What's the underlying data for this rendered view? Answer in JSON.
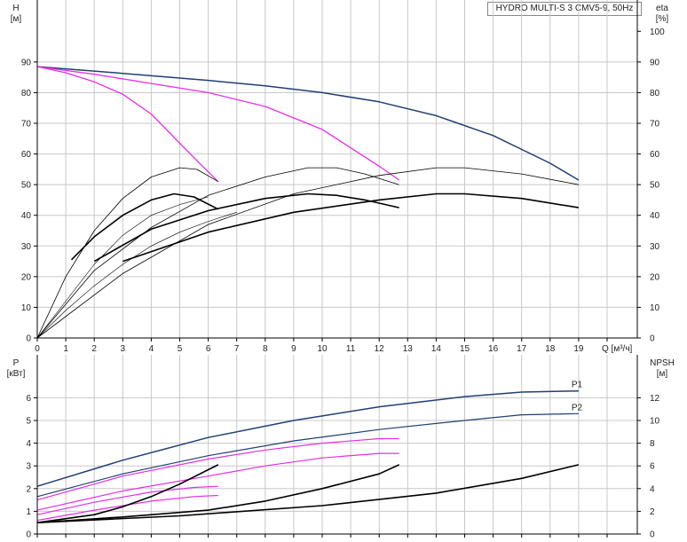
{
  "title": "HYDRO MULTI-S 3 CMV5-9, 50Hz",
  "chart_data": [
    {
      "type": "line",
      "name": "head-efficiency",
      "left_axis": {
        "label": "H",
        "unit": "[м]",
        "ylim": [
          0,
          100
        ],
        "ticks": [
          "0",
          "10",
          "20",
          "30",
          "40",
          "50",
          "60",
          "70",
          "80",
          "90"
        ]
      },
      "right_axis": {
        "label": "eta",
        "unit": "[%]",
        "ylim": [
          0,
          100
        ],
        "ticks": [
          "0",
          "10",
          "20",
          "30",
          "40",
          "50",
          "60",
          "70",
          "80",
          "90",
          "100"
        ]
      },
      "x_axis": {
        "label": "Q [м³/ч]",
        "xlim": [
          0,
          20
        ],
        "ticks": [
          "0",
          "1",
          "2",
          "3",
          "4",
          "5",
          "6",
          "7",
          "8",
          "9",
          "10",
          "11",
          "12",
          "13",
          "14",
          "15",
          "16",
          "17",
          "18",
          "19"
        ]
      },
      "grid": true,
      "series": [
        {
          "color": "#1f3f73",
          "width": 1.5,
          "points": [
            [
              0,
              88.5
            ],
            [
              3,
              86.3
            ],
            [
              6,
              84
            ],
            [
              8,
              82.2
            ],
            [
              10,
              80
            ],
            [
              12,
              77
            ],
            [
              14,
              72.5
            ],
            [
              16,
              66
            ],
            [
              18,
              57
            ],
            [
              19,
              51.5
            ]
          ]
        },
        {
          "color": "#e62ee6",
          "width": 1.3,
          "points": [
            [
              0,
              88.5
            ],
            [
              2,
              86
            ],
            [
              4,
              83
            ],
            [
              6,
              80
            ],
            [
              8,
              75.5
            ],
            [
              10,
              68
            ],
            [
              11,
              62
            ],
            [
              12,
              56
            ],
            [
              12.7,
              51.5
            ]
          ]
        },
        {
          "color": "#e62ee6",
          "width": 1.3,
          "points": [
            [
              0,
              88.5
            ],
            [
              1,
              86.5
            ],
            [
              2,
              83.5
            ],
            [
              3,
              79.5
            ],
            [
              4,
              73
            ],
            [
              5,
              63.5
            ],
            [
              5.8,
              56
            ],
            [
              6.35,
              51
            ]
          ]
        },
        {
          "color": "#000000",
          "width": 0.8,
          "points": [
            [
              0,
              0
            ],
            [
              1,
              20
            ],
            [
              2,
              35
            ],
            [
              3,
              45.5
            ],
            [
              4,
              52.5
            ],
            [
              5,
              55.5
            ],
            [
              5.6,
              55
            ],
            [
              6.35,
              51
            ]
          ]
        },
        {
          "color": "#000000",
          "width": 1.6,
          "points": [
            [
              1.2,
              25.5
            ],
            [
              2,
              33
            ],
            [
              3,
              40
            ],
            [
              4,
              45
            ],
            [
              4.8,
              47
            ],
            [
              5.5,
              46
            ],
            [
              6.35,
              42
            ]
          ]
        },
        {
          "color": "#000000",
          "width": 0.8,
          "points": [
            [
              0,
              0
            ],
            [
              2,
              22
            ],
            [
              4,
              36
            ],
            [
              6,
              46.5
            ],
            [
              8,
              52.5
            ],
            [
              9.5,
              55.5
            ],
            [
              10.5,
              55.5
            ],
            [
              11.5,
              53.5
            ],
            [
              12.7,
              50
            ]
          ]
        },
        {
          "color": "#000000",
          "width": 1.6,
          "points": [
            [
              2,
              25
            ],
            [
              4,
              35.5
            ],
            [
              6,
              41.5
            ],
            [
              8,
              45.5
            ],
            [
              9.5,
              47
            ],
            [
              10.5,
              46.5
            ],
            [
              11.5,
              45
            ],
            [
              12.7,
              42.5
            ]
          ]
        },
        {
          "color": "#000000",
          "width": 0.8,
          "points": [
            [
              0,
              0
            ],
            [
              3,
              21
            ],
            [
              6,
              37
            ],
            [
              9,
              47
            ],
            [
              12,
              53
            ],
            [
              14,
              55.5
            ],
            [
              15,
              55.5
            ],
            [
              17,
              53.5
            ],
            [
              19,
              50
            ]
          ]
        },
        {
          "color": "#000000",
          "width": 1.6,
          "points": [
            [
              3,
              25
            ],
            [
              6,
              34.5
            ],
            [
              9,
              41
            ],
            [
              12,
              45
            ],
            [
              14,
              47
            ],
            [
              15,
              47
            ],
            [
              17,
              45.5
            ],
            [
              19,
              42.5
            ]
          ]
        },
        {
          "color": "#000000",
          "width": 0.6,
          "points": [
            [
              0,
              0
            ],
            [
              1,
              12
            ],
            [
              2,
              24
            ],
            [
              3,
              33.5
            ],
            [
              4,
              40
            ],
            [
              5,
              43.5
            ],
            [
              6,
              46
            ]
          ]
        },
        {
          "color": "#000000",
          "width": 0.6,
          "points": [
            [
              0,
              0
            ],
            [
              1,
              9
            ],
            [
              2,
              17
            ],
            [
              3,
              24
            ],
            [
              4,
              30
            ],
            [
              5,
              34.5
            ],
            [
              6,
              38
            ],
            [
              7,
              41
            ]
          ]
        }
      ]
    },
    {
      "type": "line",
      "name": "power-npsh",
      "left_axis": {
        "label": "P",
        "unit": "[кВт]",
        "ylim": [
          0,
          7
        ],
        "ticks": [
          "0",
          "1",
          "2",
          "3",
          "4",
          "5",
          "6"
        ]
      },
      "right_axis": {
        "label": "NPSH",
        "unit": "[м]",
        "ylim": [
          0,
          14
        ],
        "ticks": [
          "0",
          "2",
          "4",
          "6",
          "8",
          "10",
          "12"
        ]
      },
      "x_axis": {
        "xlim": [
          0,
          20
        ]
      },
      "grid": true,
      "series": [
        {
          "name": "P1",
          "color": "#1f3f73",
          "width": 1.5,
          "points": [
            [
              0,
              2.1
            ],
            [
              3,
              3.25
            ],
            [
              6,
              4.25
            ],
            [
              9,
              5
            ],
            [
              12,
              5.6
            ],
            [
              15,
              6.05
            ],
            [
              17,
              6.25
            ],
            [
              19,
              6.3
            ]
          ]
        },
        {
          "name": "P2",
          "color": "#1f3f73",
          "width": 1.2,
          "points": [
            [
              0,
              1.65
            ],
            [
              3,
              2.65
            ],
            [
              6,
              3.45
            ],
            [
              9,
              4.1
            ],
            [
              12,
              4.6
            ],
            [
              15,
              5
            ],
            [
              17,
              5.25
            ],
            [
              19,
              5.3
            ]
          ]
        },
        {
          "color": "#e62ee6",
          "width": 1.2,
          "points": [
            [
              0,
              1.5
            ],
            [
              3,
              2.55
            ],
            [
              6,
              3.3
            ],
            [
              8,
              3.7
            ],
            [
              10,
              4
            ],
            [
              12,
              4.2
            ],
            [
              12.7,
              4.2
            ]
          ]
        },
        {
          "color": "#e62ee6",
          "width": 1.2,
          "points": [
            [
              0,
              1.05
            ],
            [
              3,
              1.9
            ],
            [
              6,
              2.55
            ],
            [
              8,
              3
            ],
            [
              10,
              3.35
            ],
            [
              12,
              3.55
            ],
            [
              12.7,
              3.55
            ]
          ]
        },
        {
          "color": "#e62ee6",
          "width": 1.2,
          "points": [
            [
              0,
              0.85
            ],
            [
              2,
              1.4
            ],
            [
              4,
              1.85
            ],
            [
              5.5,
              2.05
            ],
            [
              6.35,
              2.1
            ]
          ]
        },
        {
          "color": "#e62ee6",
          "width": 1.2,
          "points": [
            [
              0,
              0.6
            ],
            [
              2,
              1.05
            ],
            [
              4,
              1.45
            ],
            [
              5.5,
              1.65
            ],
            [
              6.35,
              1.7
            ]
          ]
        },
        {
          "color": "#000000",
          "width": 1.6,
          "points": [
            [
              0,
              0.5
            ],
            [
              2,
              0.85
            ],
            [
              3,
              1.2
            ],
            [
              4,
              1.65
            ],
            [
              5,
              2.2
            ],
            [
              6.35,
              3.05
            ]
          ]
        },
        {
          "color": "#000000",
          "width": 1.6,
          "points": [
            [
              0,
              0.5
            ],
            [
              3,
              0.75
            ],
            [
              6,
              1.05
            ],
            [
              8,
              1.45
            ],
            [
              10,
              2
            ],
            [
              12,
              2.65
            ],
            [
              12.7,
              3.05
            ]
          ]
        },
        {
          "color": "#000000",
          "width": 1.6,
          "points": [
            [
              0,
              0.5
            ],
            [
              5,
              0.8
            ],
            [
              10,
              1.25
            ],
            [
              14,
              1.8
            ],
            [
              17,
              2.45
            ],
            [
              19,
              3.05
            ]
          ]
        }
      ]
    }
  ]
}
